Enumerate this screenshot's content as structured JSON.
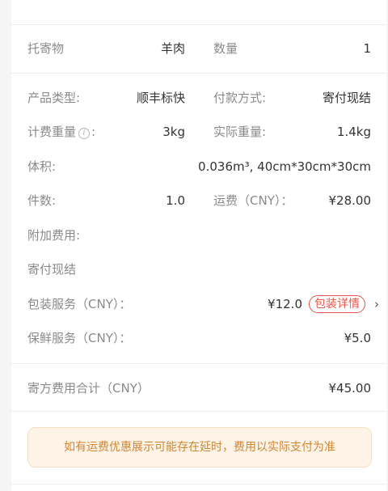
{
  "summary": {
    "goods_label": "托寄物",
    "goods_value": "羊肉",
    "quantity_label": "数量",
    "quantity_value": "1"
  },
  "details": {
    "product_type_label": "产品类型:",
    "product_type_value": "顺丰标快",
    "payment_label": "付款方式:",
    "payment_value": "寄付现结",
    "billing_weight_label": "计费重量",
    "billing_weight_info_icon": "i",
    "billing_weight_colon": ":",
    "billing_weight_value": "3kg",
    "actual_weight_label": "实际重量:",
    "actual_weight_value": "1.4kg",
    "volume_label": "体积:",
    "volume_value": "0.036m³, 40cm*30cm*30cm",
    "pieces_label": "件数:",
    "pieces_value": "1.0",
    "freight_label": "运费（CNY）：",
    "freight_value": "¥28.00",
    "extra_fee_label": "附加费用:",
    "extra_fee_payment": "寄付现结",
    "packaging_label": "包装服务（CNY）：",
    "packaging_value": "¥12.0",
    "packaging_detail_button": "包装详情",
    "fresh_label": "保鲜服务（CNY）：",
    "fresh_value": "¥5.0"
  },
  "total": {
    "label": "寄方费用合计（CNY）",
    "value": "¥45.00"
  },
  "notice": {
    "text": "如有运费优惠展示可能存在延时，费用以实际支付为准"
  },
  "colors": {
    "accent_red": "#e8564a",
    "notice_bg": "#fdf3e6",
    "notice_text": "#d08634"
  }
}
